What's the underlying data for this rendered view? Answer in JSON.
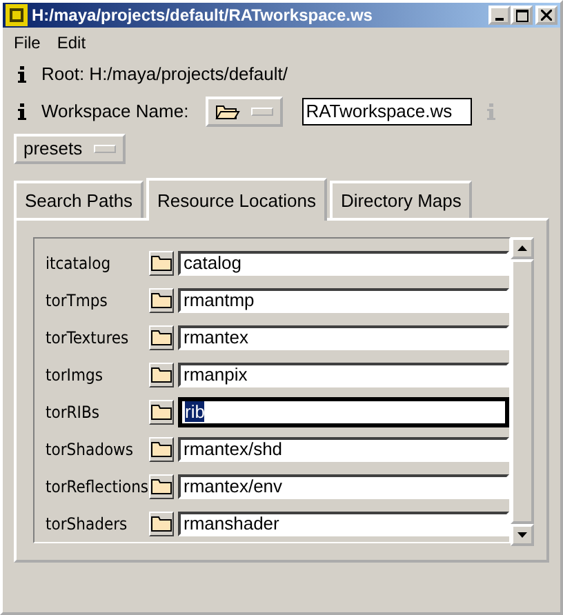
{
  "window": {
    "title": "H:/maya/projects/default/RATworkspace.ws"
  },
  "menu": [
    "File",
    "Edit"
  ],
  "root": {
    "label": "Root: H:/maya/projects/default/"
  },
  "workspace": {
    "label": "Workspace Name:",
    "value": "RATworkspace.ws"
  },
  "presets": {
    "label": "presets"
  },
  "tabs": [
    {
      "label": "Search Paths",
      "selected": false
    },
    {
      "label": "Resource Locations",
      "selected": true
    },
    {
      "label": "Directory Maps",
      "selected": false
    }
  ],
  "rows": [
    {
      "name": "itcatalog",
      "value": "catalog",
      "focused": false
    },
    {
      "name": "torTmps",
      "value": "rmantmp",
      "focused": false
    },
    {
      "name": "torTextures",
      "value": "rmantex",
      "focused": false
    },
    {
      "name": "torImgs",
      "value": "rmanpix",
      "focused": false
    },
    {
      "name": "torRIBs",
      "value": "rib",
      "focused": true
    },
    {
      "name": "torShadows",
      "value": "rmantex/shd",
      "focused": false
    },
    {
      "name": "torReflections",
      "value": "rmantex/env",
      "focused": false
    },
    {
      "name": "torShaders",
      "value": "rmanshader",
      "focused": false
    }
  ]
}
